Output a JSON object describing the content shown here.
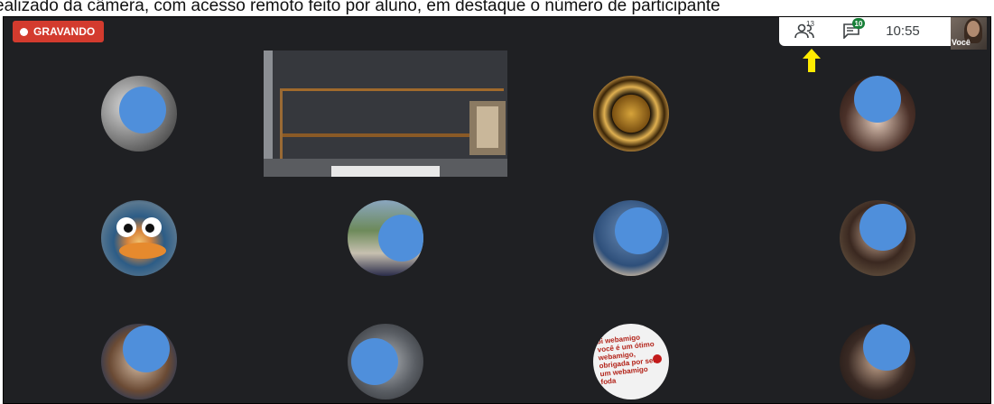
{
  "caption": "ealizado da câmera, com acesso remoto feito por aluno, em destaque o número de participante",
  "recording": {
    "label": "GRAVANDO"
  },
  "topbar": {
    "participants_count": "13",
    "chat_badge": "10",
    "time": "10:55",
    "self_label": "Você"
  },
  "icons": [
    "record-dot-icon",
    "people-icon",
    "chat-icon",
    "arrow-up-icon"
  ],
  "message_tile": {
    "text": "oi webamigo você é um ótimo webamigo, obrigada por ser um webamigo foda"
  },
  "colors": {
    "background": "#1f2023",
    "recording": "#d33b2e",
    "face_blur": "#4f8fdb",
    "highlight_arrow": "#ffeb00",
    "chat_badge": "#188038"
  }
}
